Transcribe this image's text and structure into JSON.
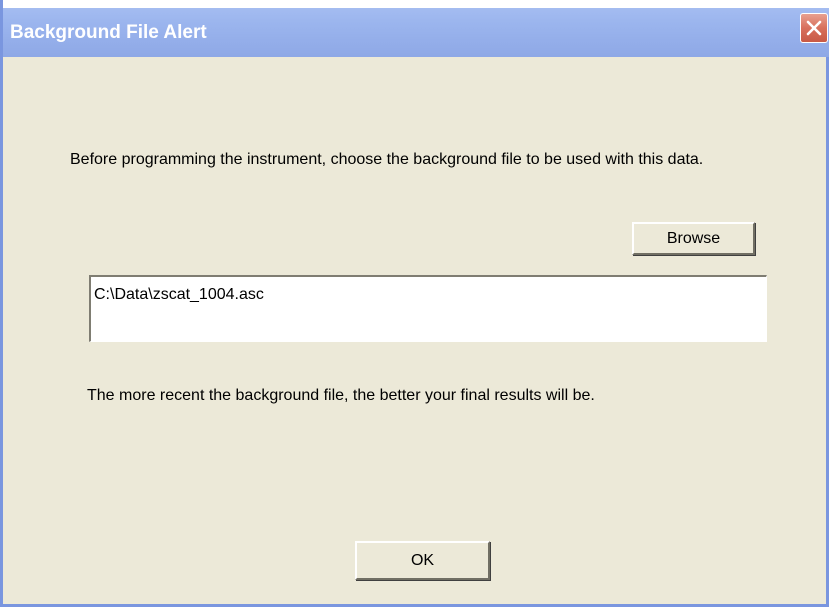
{
  "window": {
    "title": "Background File Alert",
    "close_icon": "close-icon"
  },
  "message": {
    "instruction": "Before programming the instrument, choose the background file to be used with this data.",
    "note": "The more recent the background file, the better your final results will be."
  },
  "file_field": {
    "value": "C:\\Data\\zscat_1004.asc"
  },
  "buttons": {
    "browse_label": "Browse",
    "ok_label": "OK"
  },
  "colors": {
    "titlebar": "#9bb5ee",
    "client_bg": "#ece9d8",
    "close_button": "#d8705c"
  }
}
